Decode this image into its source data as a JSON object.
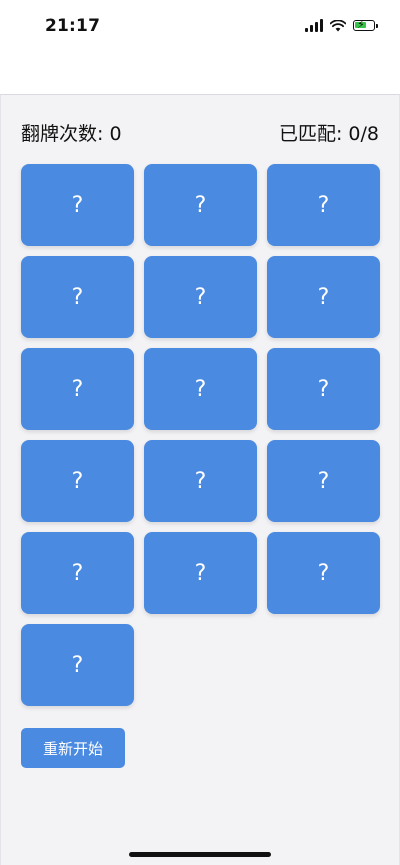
{
  "status_bar": {
    "time": "21:17",
    "icons": [
      "signal-icon",
      "wifi-icon",
      "battery-charging-icon"
    ],
    "battery_color": "#39c24a"
  },
  "header": {
    "flip_count_label": "翻牌次数: 0",
    "matched_label": "已匹配: 0/8"
  },
  "board": {
    "card_color": "#4a8ae0",
    "cards": [
      "?",
      "?",
      "?",
      "?",
      "?",
      "?",
      "?",
      "?",
      "?",
      "?",
      "?",
      "?",
      "?",
      "?",
      "?",
      "?"
    ]
  },
  "controls": {
    "restart_label": "重新开始"
  }
}
